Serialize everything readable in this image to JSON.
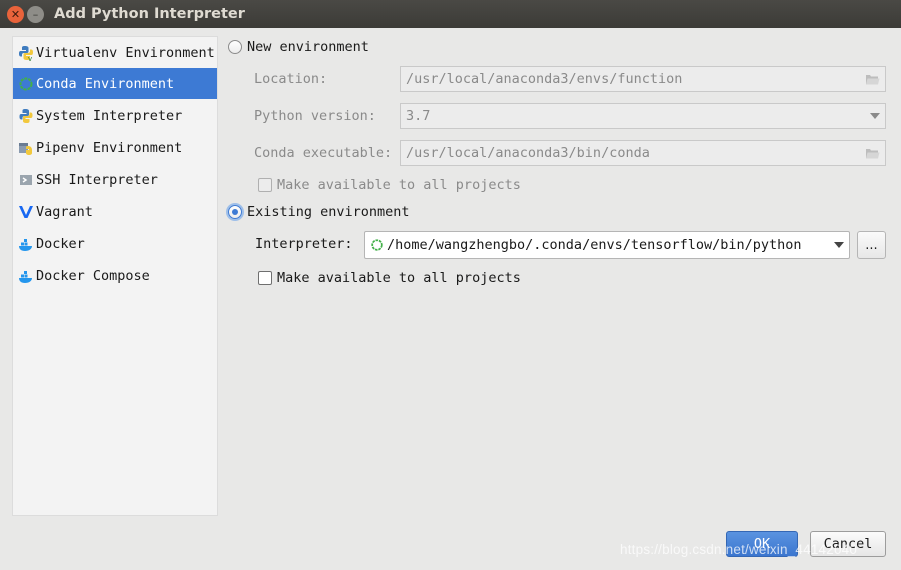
{
  "window": {
    "title": "Add Python Interpreter"
  },
  "sidebar": {
    "items": [
      {
        "label": "Virtualenv Environment",
        "icon": "virtualenv-icon",
        "selected": false
      },
      {
        "label": "Conda Environment",
        "icon": "conda-icon",
        "selected": true
      },
      {
        "label": "System Interpreter",
        "icon": "python-icon",
        "selected": false
      },
      {
        "label": "Pipenv Environment",
        "icon": "pipenv-icon",
        "selected": false
      },
      {
        "label": "SSH Interpreter",
        "icon": "ssh-terminal-icon",
        "selected": false
      },
      {
        "label": "Vagrant",
        "icon": "vagrant-icon",
        "selected": false
      },
      {
        "label": "Docker",
        "icon": "docker-icon",
        "selected": false
      },
      {
        "label": "Docker Compose",
        "icon": "docker-compose-icon",
        "selected": false
      }
    ]
  },
  "new_env": {
    "radio_label": "New environment",
    "selected": false,
    "location_label": "Location:",
    "location_value": "/usr/local/anaconda3/envs/function",
    "python_version_label": "Python version:",
    "python_version_value": "3.7",
    "conda_exec_label": "Conda executable:",
    "conda_exec_value": "/usr/local/anaconda3/bin/conda",
    "make_available_label": "Make available to all projects",
    "make_available_checked": false
  },
  "existing_env": {
    "radio_label": "Existing environment",
    "selected": true,
    "interpreter_label": "Interpreter:",
    "interpreter_value": "/home/wangzhengbo/.conda/envs/tensorflow/bin/python",
    "browse_label": "...",
    "make_available_label": "Make available to all projects",
    "make_available_checked": false
  },
  "buttons": {
    "ok_label": "OK",
    "cancel_label": "Cancel"
  },
  "watermark": "https://blog.csdn.net/weixin_44142040",
  "colors": {
    "accent": "#3d7ad4",
    "titlebar": "#3c3b37",
    "close": "#e9633b"
  }
}
